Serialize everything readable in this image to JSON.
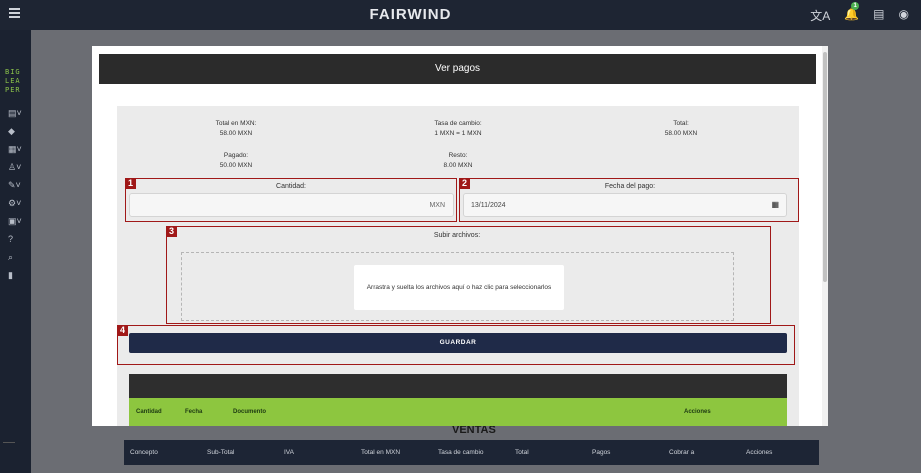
{
  "app": {
    "brand": "FAIRWIND",
    "logo_lines": [
      "BIG",
      "LEA",
      "PER"
    ],
    "notification_count": "1"
  },
  "background": {
    "section_title": "VENTAS",
    "columns": [
      "Concepto",
      "Sub-Total",
      "IVA",
      "Total en MXN",
      "Tasa de cambio",
      "Total",
      "Pagos",
      "Cobrar a",
      "Acciones"
    ]
  },
  "modal": {
    "title": "Ver pagos",
    "summary": {
      "total_mxn_label": "Total en MXN:",
      "total_mxn_value": "58.00 MXN",
      "exchange_label": "Tasa de cambio:",
      "exchange_value": "1 MXN = 1 MXN",
      "total_label": "Total:",
      "total_value": "58.00 MXN",
      "paid_label": "Pagado:",
      "paid_value": "50.00 MXN",
      "rest_label": "Resto:",
      "rest_value": "8.00 MXN"
    },
    "form": {
      "amount_label": "Cantidad:",
      "amount_value": "",
      "amount_suffix": "MXN",
      "date_label": "Fecha del pago:",
      "date_value": "13/11/2024",
      "upload_label": "Subir archivos:",
      "upload_prompt": "Arrastra y suelta los archivos aquí o haz clic para seleccionarlos",
      "save_label": "GUARDAR"
    },
    "payments_table": {
      "columns": [
        "Cantidad",
        "Fecha",
        "Documento",
        "Acciones"
      ]
    }
  },
  "annotations": [
    "1",
    "2",
    "3",
    "4"
  ],
  "colors": {
    "accent_green": "#8dc63f",
    "save_button": "#1f2a48",
    "annotation": "#a01818"
  }
}
